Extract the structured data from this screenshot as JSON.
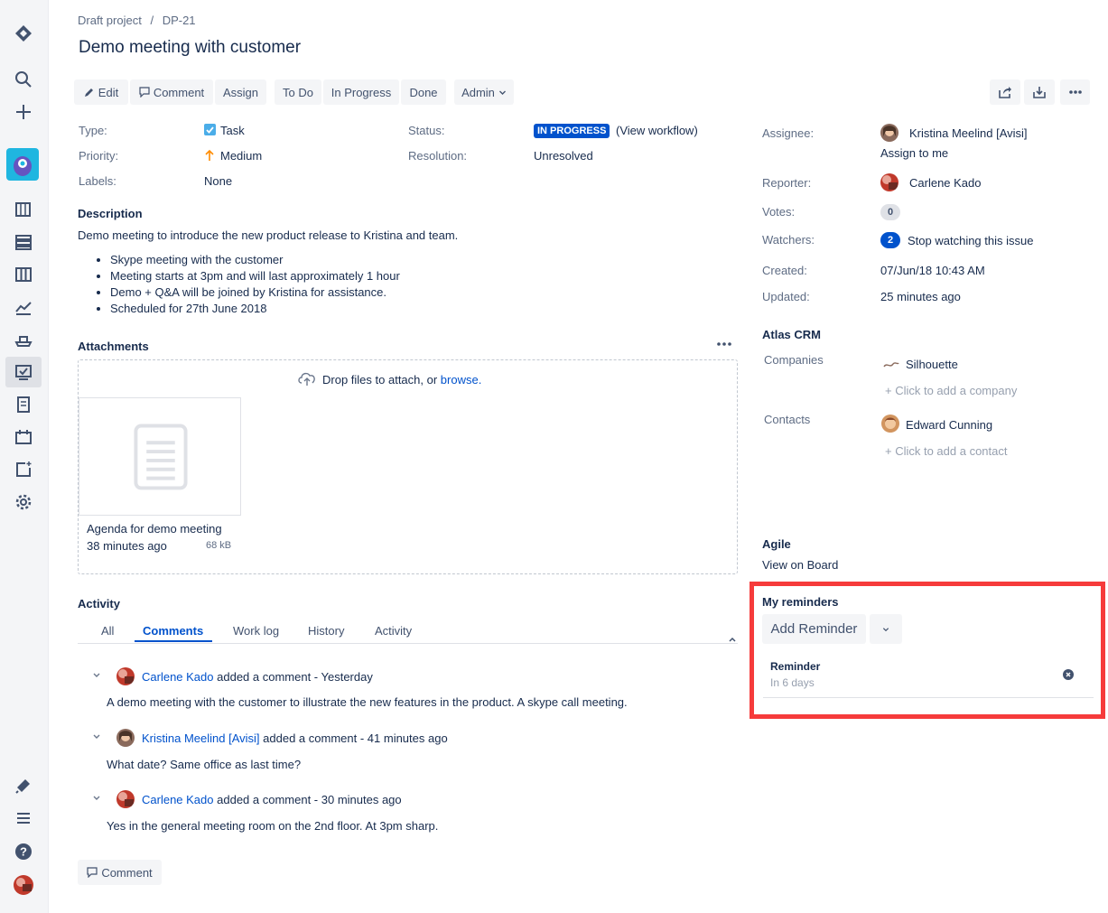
{
  "breadcrumb": {
    "project": "Draft project",
    "separator": "/",
    "issue_key": "DP-21"
  },
  "issue": {
    "title": "Demo meeting with customer"
  },
  "toolbar": {
    "edit": "Edit",
    "comment": "Comment",
    "assign": "Assign",
    "todo": "To Do",
    "in_progress": "In Progress",
    "done": "Done",
    "admin": "Admin"
  },
  "details": {
    "type_label": "Type:",
    "type_value": "Task",
    "priority_label": "Priority:",
    "priority_value": "Medium",
    "labels_label": "Labels:",
    "labels_value": "None",
    "status_label": "Status:",
    "status_value": "IN PROGRESS",
    "view_workflow": "(View workflow)",
    "resolution_label": "Resolution:",
    "resolution_value": "Unresolved"
  },
  "description": {
    "heading": "Description",
    "text": "Demo meeting to introduce the new product release to Kristina and team.",
    "bullets": [
      "Skype meeting with the customer",
      "Meeting starts at 3pm and will last approximately 1 hour",
      "Demo + Q&A will be joined by Kristina for assistance.",
      "Scheduled for 27th June 2018"
    ]
  },
  "attachments": {
    "heading": "Attachments",
    "drop_text": "Drop files to attach, or",
    "browse": "browse.",
    "file_name": "Agenda for demo meeting",
    "file_time": "38 minutes ago",
    "file_size": "68 kB"
  },
  "activity": {
    "heading": "Activity",
    "tabs": [
      "All",
      "Comments",
      "Work log",
      "History",
      "Activity"
    ],
    "comments": [
      {
        "author": "Carlene Kado",
        "action": "added a comment - Yesterday",
        "body": "A demo meeting with the customer to illustrate the new features in the product. A skype call meeting."
      },
      {
        "author": "Kristina Meelind [Avisi]",
        "action": "added a comment - 41 minutes ago",
        "body": "What date? Same office as last time?"
      },
      {
        "author": "Carlene Kado",
        "action": "added a comment - 30 minutes ago",
        "body": "Yes in the general meeting room on the 2nd floor. At 3pm sharp."
      }
    ],
    "comment_button": "Comment"
  },
  "people": {
    "assignee_label": "Assignee:",
    "assignee": "Kristina Meelind [Avisi]",
    "assign_to_me": "Assign to me",
    "reporter_label": "Reporter:",
    "reporter": "Carlene Kado",
    "votes_label": "Votes:",
    "votes": "0",
    "watchers_label": "Watchers:",
    "watchers": "2",
    "stop_watching": "Stop watching this issue"
  },
  "dates": {
    "created_label": "Created:",
    "created": "07/Jun/18 10:43 AM",
    "updated_label": "Updated:",
    "updated": "25 minutes ago"
  },
  "crm": {
    "heading": "Atlas CRM",
    "companies_label": "Companies",
    "company": "Silhouette",
    "add_company": "+ Click to add a company",
    "contacts_label": "Contacts",
    "contact": "Edward Cunning",
    "add_contact": "+ Click to add a contact"
  },
  "agile": {
    "heading": "Agile",
    "view_on_board": "View on Board"
  },
  "reminders": {
    "heading": "My reminders",
    "add_button": "Add Reminder",
    "item_title": "Reminder",
    "item_due": "In 6 days"
  },
  "colors": {
    "accent": "#0052cc",
    "highlight_box": "#f63b3b",
    "sidebar_bg": "#f4f5f7",
    "app_brand": "#1fb6e0"
  }
}
